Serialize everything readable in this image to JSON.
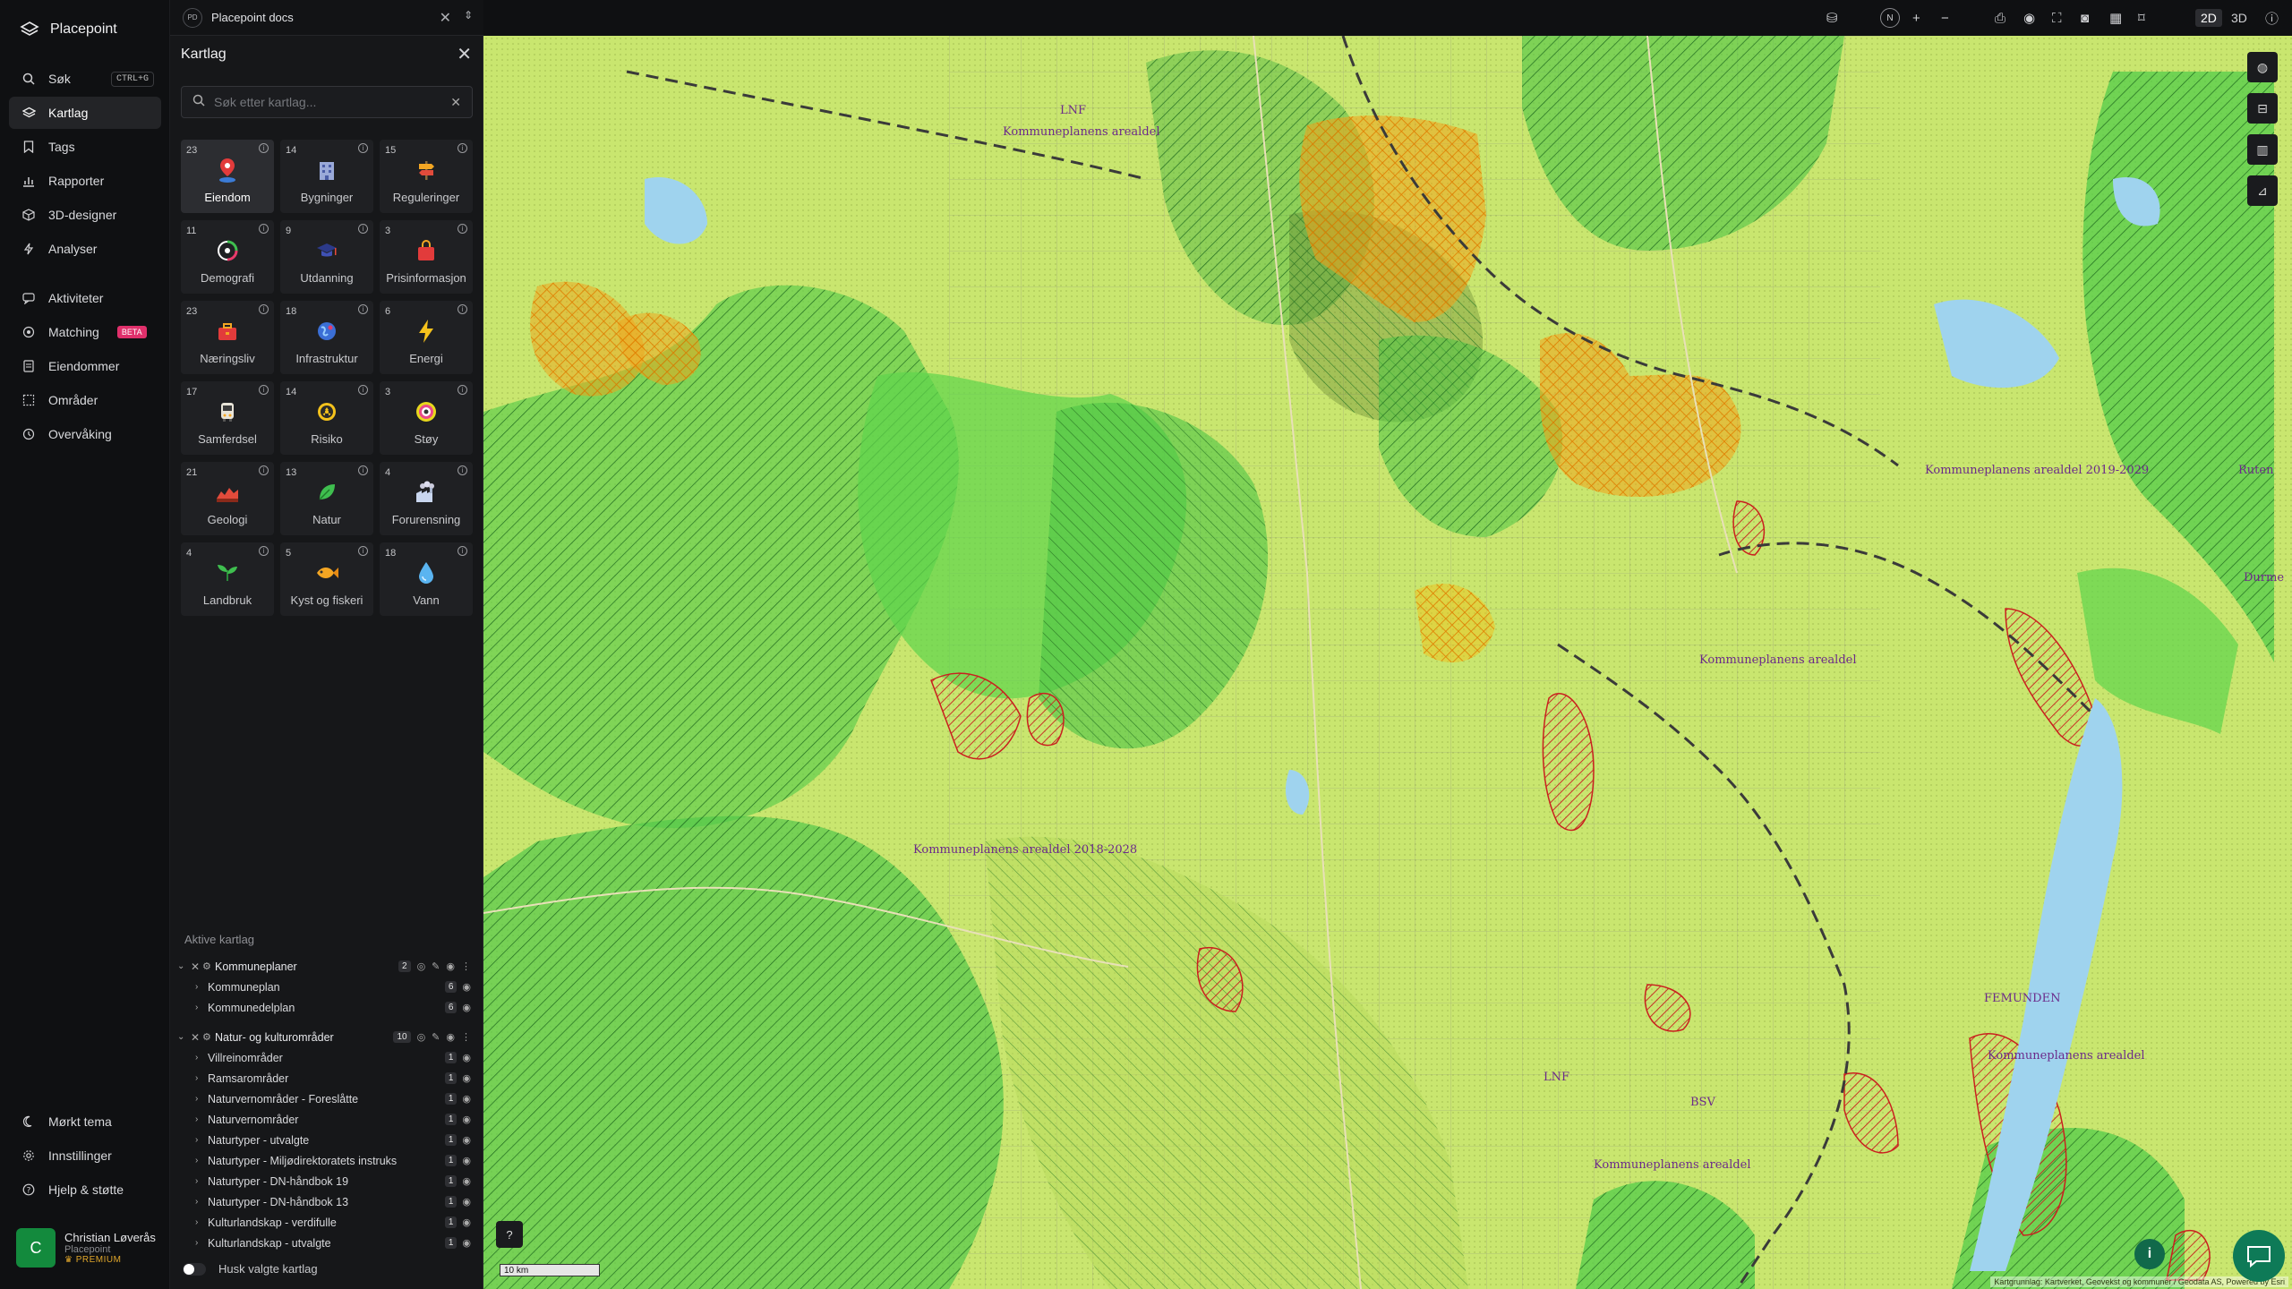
{
  "app": {
    "name": "Placepoint"
  },
  "nav": {
    "items": [
      {
        "label": "Søk",
        "icon": "search-icon",
        "shortcut": "CTRL+G"
      },
      {
        "label": "Kartlag",
        "icon": "layers-icon",
        "active": true
      },
      {
        "label": "Tags",
        "icon": "bookmark-icon"
      },
      {
        "label": "Rapporter",
        "icon": "bar-chart-icon"
      },
      {
        "label": "3D-designer",
        "icon": "cube-icon"
      },
      {
        "label": "Analyser",
        "icon": "lightning-icon"
      }
    ],
    "items2": [
      {
        "label": "Aktiviteter",
        "icon": "chat-icon"
      },
      {
        "label": "Matching",
        "icon": "target-icon",
        "badge": "BETA"
      },
      {
        "label": "Eiendommer",
        "icon": "document-icon"
      },
      {
        "label": "Områder",
        "icon": "area-icon"
      },
      {
        "label": "Overvåking",
        "icon": "clock-icon"
      }
    ],
    "bottom": [
      {
        "label": "Mørkt tema",
        "icon": "moon-icon"
      },
      {
        "label": "Innstillinger",
        "icon": "gear-icon"
      },
      {
        "label": "Hjelp & støtte",
        "icon": "help-icon"
      }
    ],
    "user": {
      "initial": "C",
      "name": "Christian Løverås",
      "org": "Placepoint",
      "plan": "PREMIUM"
    }
  },
  "workspace": {
    "badge": "PD",
    "name": "Placepoint docs"
  },
  "panel": {
    "title": "Kartlag",
    "search_placeholder": "Søk etter kartlag...",
    "categories": [
      {
        "count": "23",
        "label": "Eiendom",
        "icon": "pin-icon",
        "selected": true
      },
      {
        "count": "14",
        "label": "Bygninger",
        "icon": "building-icon"
      },
      {
        "count": "15",
        "label": "Reguleringer",
        "icon": "signpost-icon"
      },
      {
        "count": "11",
        "label": "Demografi",
        "icon": "demography-icon"
      },
      {
        "count": "9",
        "label": "Utdanning",
        "icon": "graduation-icon"
      },
      {
        "count": "3",
        "label": "Prisinformasjon",
        "icon": "shopping-bag-icon"
      },
      {
        "count": "23",
        "label": "Næringsliv",
        "icon": "briefcase-icon"
      },
      {
        "count": "18",
        "label": "Infrastruktur",
        "icon": "globe-icon"
      },
      {
        "count": "6",
        "label": "Energi",
        "icon": "bolt-icon"
      },
      {
        "count": "17",
        "label": "Samferdsel",
        "icon": "bus-icon"
      },
      {
        "count": "14",
        "label": "Risiko",
        "icon": "hazard-icon"
      },
      {
        "count": "3",
        "label": "Støy",
        "icon": "noise-icon"
      },
      {
        "count": "21",
        "label": "Geologi",
        "icon": "geology-icon"
      },
      {
        "count": "13",
        "label": "Natur",
        "icon": "leaf-icon"
      },
      {
        "count": "4",
        "label": "Forurensning",
        "icon": "factory-icon"
      },
      {
        "count": "4",
        "label": "Landbruk",
        "icon": "sprout-icon"
      },
      {
        "count": "5",
        "label": "Kyst og fiskeri",
        "icon": "fish-icon"
      },
      {
        "count": "18",
        "label": "Vann",
        "icon": "water-drop-icon"
      }
    ],
    "active_header": "Aktive kartlag",
    "groups": [
      {
        "name": "Kommuneplaner",
        "count": "2",
        "children": [
          {
            "name": "Kommuneplan",
            "count": "6"
          },
          {
            "name": "Kommunedelplan",
            "count": "6"
          }
        ]
      },
      {
        "name": "Natur- og kulturområder",
        "count": "10",
        "children": [
          {
            "name": "Villreinområder",
            "count": "1"
          },
          {
            "name": "Ramsarområder",
            "count": "1"
          },
          {
            "name": "Naturvernområder - Foreslåtte",
            "count": "1"
          },
          {
            "name": "Naturvernområder",
            "count": "1"
          },
          {
            "name": "Naturtyper - utvalgte",
            "count": "1"
          },
          {
            "name": "Naturtyper - Miljødirektoratets instruks",
            "count": "1"
          },
          {
            "name": "Naturtyper - DN-håndbok 19",
            "count": "1"
          },
          {
            "name": "Naturtyper - DN-håndbok 13",
            "count": "1"
          },
          {
            "name": "Kulturlandskap - verdifulle",
            "count": "1"
          },
          {
            "name": "Kulturlandskap - utvalgte",
            "count": "1"
          }
        ]
      }
    ],
    "remember_label": "Husk valgte kartlag"
  },
  "topbar": {
    "north": "N",
    "mode_2d": "2D",
    "mode_3d": "3D",
    "active_mode": "2D"
  },
  "map": {
    "scale_label": "10 km",
    "attribution": "Kartgrunnlag: Kartverket, Geovekst og kommuner / Geodata AS, Powered by Esri",
    "labels": [
      "Kommuneplanens arealdel",
      "Kommuneplanens arealdel 2019-2029",
      "Kommuneplanens arealdel",
      "Kommuneplanens arealdel 2018-2028",
      "Kommuneplanens arealdel",
      "Kommuneplanens arealdel",
      "LNF",
      "LNF",
      "BSV",
      "FEMUNDEN",
      "Durme",
      "Ruten"
    ],
    "colors": {
      "base": "#c9e66f",
      "green": "#4fc94a",
      "orange": "#f2a21a",
      "red": "#d93a3a",
      "water": "#9fd3ee"
    }
  }
}
